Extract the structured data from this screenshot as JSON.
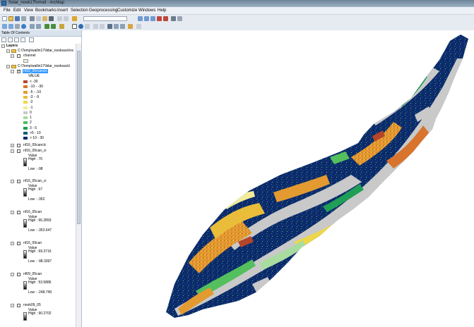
{
  "window": {
    "title": "Solar_nook17fsmod - ArcMap"
  },
  "menu": [
    "File",
    "Edit",
    "View",
    "Bookmarks",
    "Insert",
    "Selection",
    "Geoprocessing",
    "Customize",
    "Windows",
    "Help"
  ],
  "toc": {
    "title": "Table Of Contents",
    "root": "Layers",
    "group1": {
      "path": "C:\\Temp\\wallin17\\lidar_nooksack\\nc",
      "layer": "channel"
    },
    "group2": {
      "path": "C:\\Temp\\wallin17\\lidar_nooksack\\",
      "selected_layer": "nf16_05rcanclc",
      "field": "VALUE",
      "classes": [
        {
          "label": "< -30",
          "color": "#b5462a"
        },
        {
          "label": "-10 - -30",
          "color": "#d8742e"
        },
        {
          "label": "-5 - -10",
          "color": "#e39a30"
        },
        {
          "label": "-3 - -5",
          "color": "#e9bd3a"
        },
        {
          "label": "-2",
          "color": "#eed748"
        },
        {
          "label": "-1",
          "color": "#f2ec9a"
        },
        {
          "label": "0",
          "color": "#c9c9c9"
        },
        {
          "label": "1",
          "color": "#a9dca0"
        },
        {
          "label": "2",
          "color": "#53c05d"
        },
        {
          "label": "3 - 5",
          "color": "#1f9f56"
        },
        {
          "label": ">5 - 10",
          "color": "#155e77"
        },
        {
          "label": "> 10 - 30",
          "color": "#0d2a6e"
        }
      ]
    },
    "layers": [
      {
        "name": "nf16_09canclc",
        "expanded": false
      },
      {
        "name": "nf16_09can_ci",
        "value": "Value",
        "high": "High : 70",
        "low": "Low : -98"
      },
      {
        "name": "nf16_05can_ci",
        "value": "Value",
        "high": "High : 67",
        "low": "Low : -352"
      },
      {
        "name": "nf16_05can",
        "value": "Value",
        "high": "High : 66.2893",
        "low": "Low : -353.547"
      },
      {
        "name": "nf16_09can",
        "value": "Value",
        "high": "High : 69.3716",
        "low": "Low : -98.3397"
      },
      {
        "name": "nf09_05can",
        "value": "Value",
        "high": "High : 53.5886",
        "low": "Low : -248.749"
      },
      {
        "name": "nook09_05",
        "value": "Value",
        "high": "High : 90.2702",
        "low": ""
      }
    ]
  },
  "colors": {
    "window_bg": "#ffffff",
    "selection": "#3399ff",
    "title_bar": "#6c8398"
  }
}
